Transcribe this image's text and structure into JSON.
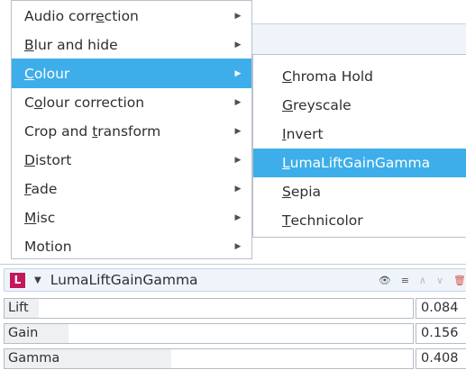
{
  "menu": {
    "items": [
      {
        "pre": "Audio corr",
        "u": "e",
        "post": "ction"
      },
      {
        "pre": "",
        "u": "B",
        "post": "lur and hide"
      },
      {
        "pre": "",
        "u": "C",
        "post": "olour"
      },
      {
        "pre": "C",
        "u": "o",
        "post": "lour correction"
      },
      {
        "pre": "Crop and ",
        "u": "t",
        "post": "ransform"
      },
      {
        "pre": "",
        "u": "D",
        "post": "istort"
      },
      {
        "pre": "",
        "u": "F",
        "post": "ade"
      },
      {
        "pre": "",
        "u": "M",
        "post": "isc"
      },
      {
        "pre": "Motion",
        "u": "",
        "post": ""
      }
    ],
    "arrow": "▶"
  },
  "submenu": {
    "items": [
      {
        "pre": "",
        "u": "C",
        "post": "hroma Hold"
      },
      {
        "pre": "",
        "u": "G",
        "post": "reyscale"
      },
      {
        "pre": "",
        "u": "I",
        "post": "nvert"
      },
      {
        "pre": "",
        "u": "L",
        "post": "umaLiftGainGamma"
      },
      {
        "pre": "",
        "u": "S",
        "post": "epia"
      },
      {
        "pre": "",
        "u": "T",
        "post": "echnicolor"
      }
    ]
  },
  "panel": {
    "badge": "L",
    "collapse_icon": "▼",
    "title": "LumaLiftGainGamma",
    "icons": {
      "eye": "👁",
      "menu": "≡",
      "up": "∧",
      "down": "∨",
      "remove": "🗑"
    },
    "params": [
      {
        "name": "Lift",
        "value": "0.084",
        "level": 0.084
      },
      {
        "name": "Gain",
        "value": "0.156",
        "level": 0.156
      },
      {
        "name": "Gamma",
        "value": "0.408",
        "level": 0.408
      }
    ]
  },
  "colors": {
    "highlight": "#3daee9",
    "badge": "#c2185b"
  }
}
